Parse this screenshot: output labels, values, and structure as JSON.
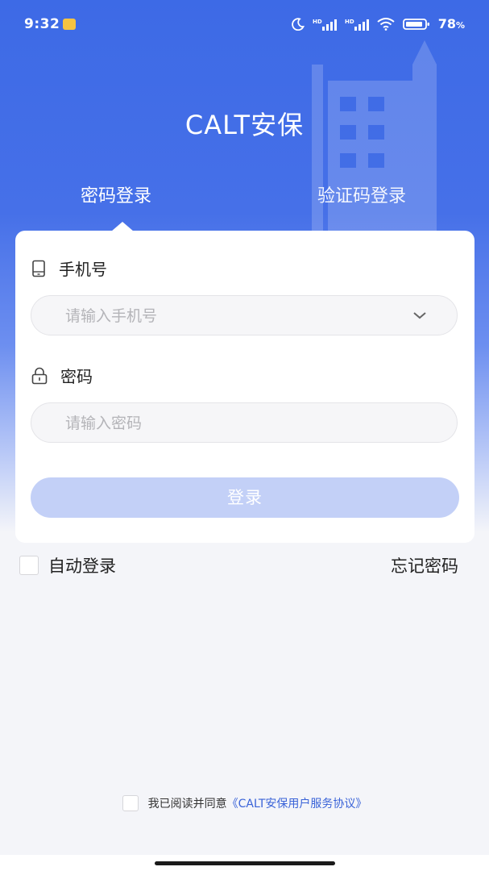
{
  "status_bar": {
    "time": "9:32",
    "battery_percent": "78",
    "battery_unit": "%",
    "icons": [
      "moon-icon",
      "signal-icon",
      "signal-icon",
      "wifi-icon",
      "battery-icon"
    ],
    "hd_label": "HD"
  },
  "header": {
    "title": "CALT安保"
  },
  "tabs": [
    {
      "label": "密码登录",
      "active": true
    },
    {
      "label": "验证码登录",
      "active": false
    }
  ],
  "form": {
    "phone_label": "手机号",
    "phone_placeholder": "请输入手机号",
    "phone_value": "",
    "password_label": "密码",
    "password_placeholder": "请输入密码",
    "password_value": "",
    "login_button": "登录"
  },
  "options": {
    "auto_login_label": "自动登录",
    "auto_login_checked": false,
    "forgot_password": "忘记密码"
  },
  "agreement": {
    "text": "我已阅读并同意",
    "link_text": "《CALT安保用户服务协议》",
    "checked": false
  },
  "colors": {
    "brand_blue": "#3d6ae6",
    "button_disabled": "#c3d0f7",
    "link": "#3a63d8"
  }
}
